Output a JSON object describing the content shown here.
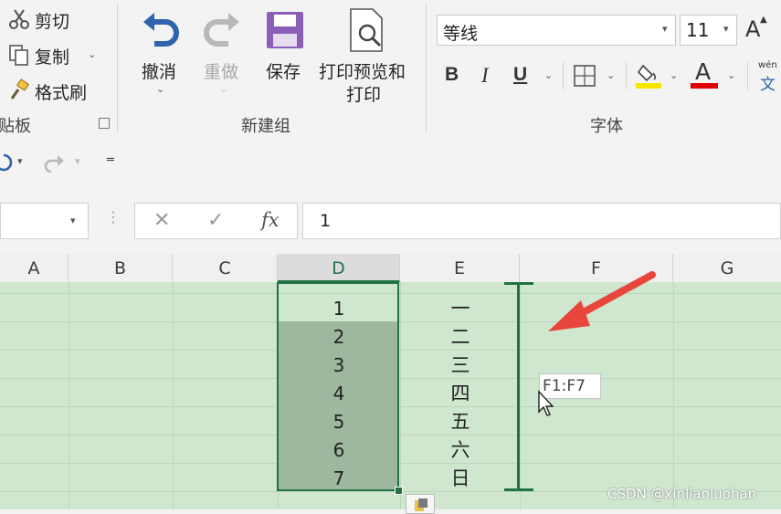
{
  "clipboard": {
    "cut": "剪切",
    "copy": "复制",
    "format_painter": "格式刷",
    "group_label": "贴板"
  },
  "newgroup": {
    "undo": "撤消",
    "redo": "重做",
    "save": "保存",
    "print_preview_line1": "打印预览和",
    "print_preview_line2": "打印",
    "group_label": "新建组"
  },
  "font": {
    "font_name": "等线",
    "font_size": "11",
    "bold": "B",
    "italic": "I",
    "underline": "U",
    "grow_font": "A",
    "font_color_letter": "A",
    "phonetic_top": "wén",
    "phonetic_bottom": "文",
    "group_label": "字体",
    "highlight_color": "#f5e600",
    "font_color": "#e00000"
  },
  "formula_bar": {
    "fx": "fx",
    "value": "1"
  },
  "columns": [
    "A",
    "B",
    "C",
    "D",
    "E",
    "F",
    "G"
  ],
  "selected_column": "D",
  "column_d": [
    "1",
    "2",
    "3",
    "4",
    "5",
    "6",
    "7"
  ],
  "column_e": [
    "一",
    "二",
    "三",
    "四",
    "五",
    "六",
    "日"
  ],
  "tooltip": "F1:F7",
  "watermark": "CSDN @xinlianluohan",
  "colors": {
    "accent_green": "#217346",
    "sheet_bg": "#cfe6cf",
    "selection_fill": "#9db89f",
    "arrow_red": "#e8463c"
  }
}
